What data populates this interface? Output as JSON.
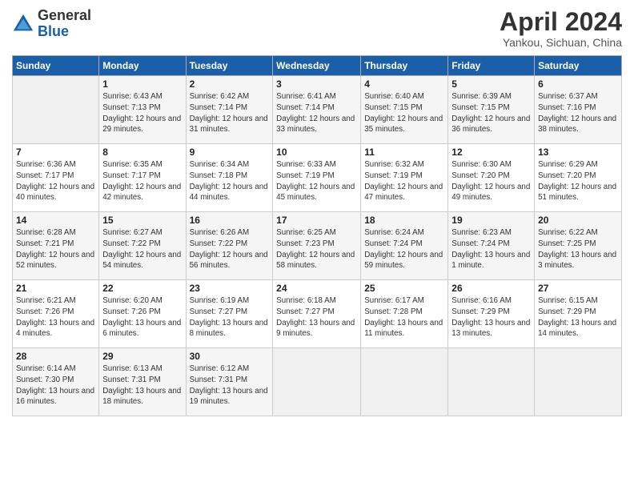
{
  "logo": {
    "general": "General",
    "blue": "Blue"
  },
  "title": "April 2024",
  "subtitle": "Yankou, Sichuan, China",
  "headers": [
    "Sunday",
    "Monday",
    "Tuesday",
    "Wednesday",
    "Thursday",
    "Friday",
    "Saturday"
  ],
  "rows": [
    [
      {
        "day": "",
        "sunrise": "",
        "sunset": "",
        "daylight": ""
      },
      {
        "day": "1",
        "sunrise": "Sunrise: 6:43 AM",
        "sunset": "Sunset: 7:13 PM",
        "daylight": "Daylight: 12 hours and 29 minutes."
      },
      {
        "day": "2",
        "sunrise": "Sunrise: 6:42 AM",
        "sunset": "Sunset: 7:14 PM",
        "daylight": "Daylight: 12 hours and 31 minutes."
      },
      {
        "day": "3",
        "sunrise": "Sunrise: 6:41 AM",
        "sunset": "Sunset: 7:14 PM",
        "daylight": "Daylight: 12 hours and 33 minutes."
      },
      {
        "day": "4",
        "sunrise": "Sunrise: 6:40 AM",
        "sunset": "Sunset: 7:15 PM",
        "daylight": "Daylight: 12 hours and 35 minutes."
      },
      {
        "day": "5",
        "sunrise": "Sunrise: 6:39 AM",
        "sunset": "Sunset: 7:15 PM",
        "daylight": "Daylight: 12 hours and 36 minutes."
      },
      {
        "day": "6",
        "sunrise": "Sunrise: 6:37 AM",
        "sunset": "Sunset: 7:16 PM",
        "daylight": "Daylight: 12 hours and 38 minutes."
      }
    ],
    [
      {
        "day": "7",
        "sunrise": "Sunrise: 6:36 AM",
        "sunset": "Sunset: 7:17 PM",
        "daylight": "Daylight: 12 hours and 40 minutes."
      },
      {
        "day": "8",
        "sunrise": "Sunrise: 6:35 AM",
        "sunset": "Sunset: 7:17 PM",
        "daylight": "Daylight: 12 hours and 42 minutes."
      },
      {
        "day": "9",
        "sunrise": "Sunrise: 6:34 AM",
        "sunset": "Sunset: 7:18 PM",
        "daylight": "Daylight: 12 hours and 44 minutes."
      },
      {
        "day": "10",
        "sunrise": "Sunrise: 6:33 AM",
        "sunset": "Sunset: 7:19 PM",
        "daylight": "Daylight: 12 hours and 45 minutes."
      },
      {
        "day": "11",
        "sunrise": "Sunrise: 6:32 AM",
        "sunset": "Sunset: 7:19 PM",
        "daylight": "Daylight: 12 hours and 47 minutes."
      },
      {
        "day": "12",
        "sunrise": "Sunrise: 6:30 AM",
        "sunset": "Sunset: 7:20 PM",
        "daylight": "Daylight: 12 hours and 49 minutes."
      },
      {
        "day": "13",
        "sunrise": "Sunrise: 6:29 AM",
        "sunset": "Sunset: 7:20 PM",
        "daylight": "Daylight: 12 hours and 51 minutes."
      }
    ],
    [
      {
        "day": "14",
        "sunrise": "Sunrise: 6:28 AM",
        "sunset": "Sunset: 7:21 PM",
        "daylight": "Daylight: 12 hours and 52 minutes."
      },
      {
        "day": "15",
        "sunrise": "Sunrise: 6:27 AM",
        "sunset": "Sunset: 7:22 PM",
        "daylight": "Daylight: 12 hours and 54 minutes."
      },
      {
        "day": "16",
        "sunrise": "Sunrise: 6:26 AM",
        "sunset": "Sunset: 7:22 PM",
        "daylight": "Daylight: 12 hours and 56 minutes."
      },
      {
        "day": "17",
        "sunrise": "Sunrise: 6:25 AM",
        "sunset": "Sunset: 7:23 PM",
        "daylight": "Daylight: 12 hours and 58 minutes."
      },
      {
        "day": "18",
        "sunrise": "Sunrise: 6:24 AM",
        "sunset": "Sunset: 7:24 PM",
        "daylight": "Daylight: 12 hours and 59 minutes."
      },
      {
        "day": "19",
        "sunrise": "Sunrise: 6:23 AM",
        "sunset": "Sunset: 7:24 PM",
        "daylight": "Daylight: 13 hours and 1 minute."
      },
      {
        "day": "20",
        "sunrise": "Sunrise: 6:22 AM",
        "sunset": "Sunset: 7:25 PM",
        "daylight": "Daylight: 13 hours and 3 minutes."
      }
    ],
    [
      {
        "day": "21",
        "sunrise": "Sunrise: 6:21 AM",
        "sunset": "Sunset: 7:26 PM",
        "daylight": "Daylight: 13 hours and 4 minutes."
      },
      {
        "day": "22",
        "sunrise": "Sunrise: 6:20 AM",
        "sunset": "Sunset: 7:26 PM",
        "daylight": "Daylight: 13 hours and 6 minutes."
      },
      {
        "day": "23",
        "sunrise": "Sunrise: 6:19 AM",
        "sunset": "Sunset: 7:27 PM",
        "daylight": "Daylight: 13 hours and 8 minutes."
      },
      {
        "day": "24",
        "sunrise": "Sunrise: 6:18 AM",
        "sunset": "Sunset: 7:27 PM",
        "daylight": "Daylight: 13 hours and 9 minutes."
      },
      {
        "day": "25",
        "sunrise": "Sunrise: 6:17 AM",
        "sunset": "Sunset: 7:28 PM",
        "daylight": "Daylight: 13 hours and 11 minutes."
      },
      {
        "day": "26",
        "sunrise": "Sunrise: 6:16 AM",
        "sunset": "Sunset: 7:29 PM",
        "daylight": "Daylight: 13 hours and 13 minutes."
      },
      {
        "day": "27",
        "sunrise": "Sunrise: 6:15 AM",
        "sunset": "Sunset: 7:29 PM",
        "daylight": "Daylight: 13 hours and 14 minutes."
      }
    ],
    [
      {
        "day": "28",
        "sunrise": "Sunrise: 6:14 AM",
        "sunset": "Sunset: 7:30 PM",
        "daylight": "Daylight: 13 hours and 16 minutes."
      },
      {
        "day": "29",
        "sunrise": "Sunrise: 6:13 AM",
        "sunset": "Sunset: 7:31 PM",
        "daylight": "Daylight: 13 hours and 18 minutes."
      },
      {
        "day": "30",
        "sunrise": "Sunrise: 6:12 AM",
        "sunset": "Sunset: 7:31 PM",
        "daylight": "Daylight: 13 hours and 19 minutes."
      },
      {
        "day": "",
        "sunrise": "",
        "sunset": "",
        "daylight": ""
      },
      {
        "day": "",
        "sunrise": "",
        "sunset": "",
        "daylight": ""
      },
      {
        "day": "",
        "sunrise": "",
        "sunset": "",
        "daylight": ""
      },
      {
        "day": "",
        "sunrise": "",
        "sunset": "",
        "daylight": ""
      }
    ]
  ]
}
